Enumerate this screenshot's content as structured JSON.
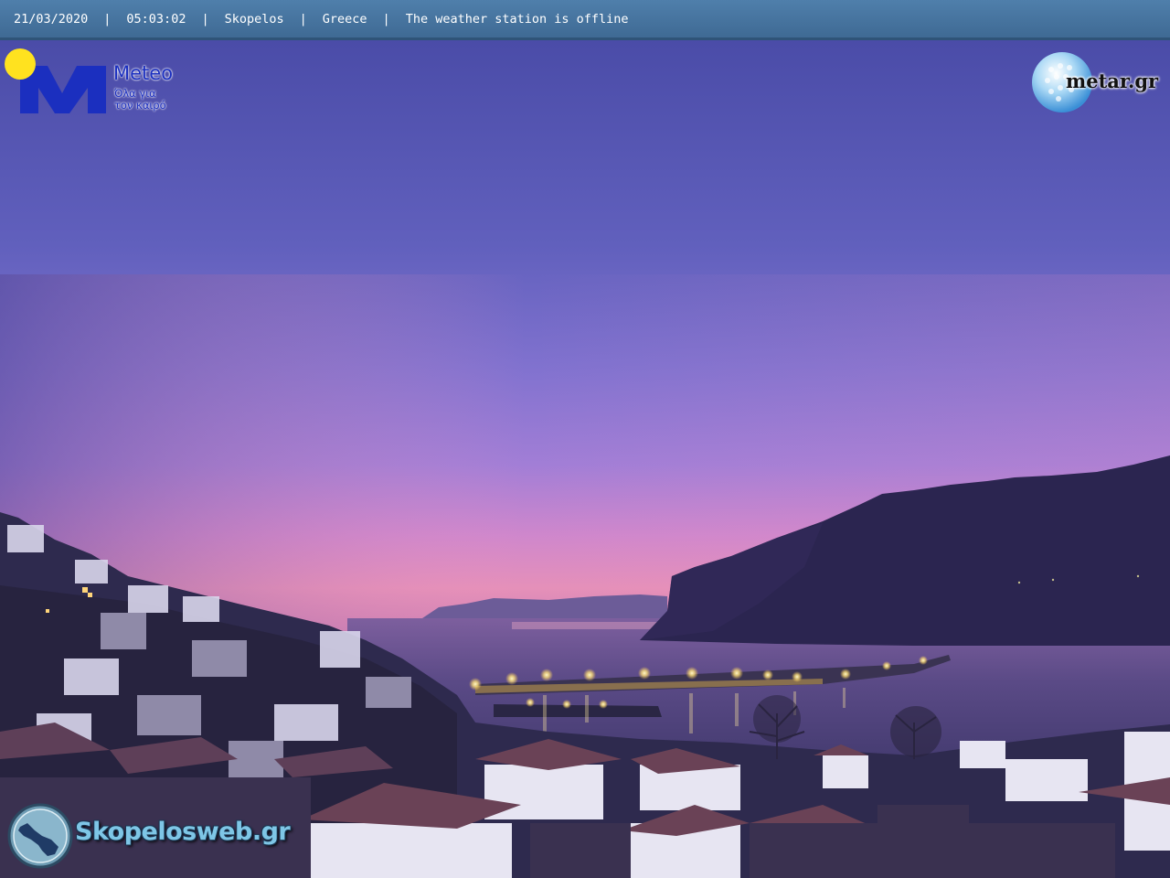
{
  "status_bar": {
    "date": "21/03/2020",
    "time": "05:03:02",
    "location": "Skopelos",
    "country": "Greece",
    "status": "The weather station is offline",
    "separator": "|"
  },
  "logos": {
    "meteo": {
      "title": "Meteo",
      "slogan_line1": "Όλα για",
      "slogan_line2": "τον καιρό",
      "icon": "meteo-m-sun-icon"
    },
    "metar": {
      "text": "metar.gr",
      "icon": "golf-ball-globe-icon"
    },
    "skopelos": {
      "text": "Skopelosweb.gr",
      "icon": "island-map-icon"
    }
  },
  "colors": {
    "status_bar": "#4a79a5",
    "meteo_blue": "#1b2fbf",
    "sun_yellow": "#ffe21f",
    "skopelos_text": "#7ec6e6"
  }
}
